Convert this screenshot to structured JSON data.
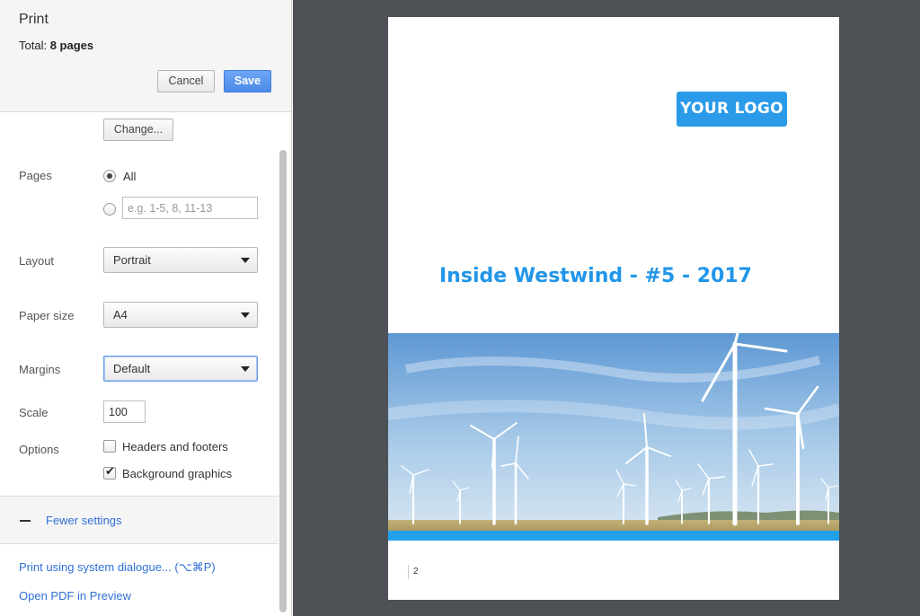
{
  "header": {
    "title": "Print",
    "total_label": "Total:",
    "total_value": "8 pages",
    "cancel_label": "Cancel",
    "save_label": "Save"
  },
  "destination": {
    "change_label": "Change..."
  },
  "pages": {
    "label": "Pages",
    "all_label": "All",
    "selected": "All",
    "custom_placeholder": "e.g. 1-5, 8, 11-13",
    "custom_value": ""
  },
  "layout": {
    "label": "Layout",
    "value": "Portrait"
  },
  "paper_size": {
    "label": "Paper size",
    "value": "A4"
  },
  "margins": {
    "label": "Margins",
    "value": "Default"
  },
  "scale": {
    "label": "Scale",
    "value": "100"
  },
  "options": {
    "label": "Options",
    "headers_footers_label": "Headers and footers",
    "headers_footers_checked": false,
    "background_graphics_label": "Background graphics",
    "background_graphics_checked": true
  },
  "fewer_settings_label": "Fewer settings",
  "links": {
    "system_dialogue": "Print using system dialogue... (⌥⌘P)",
    "open_pdf": "Open PDF in Preview"
  },
  "preview": {
    "logo_text": "YOUR LOGO",
    "title": "Inside Westwind - #5 - 2017",
    "page_number": "2"
  },
  "colors": {
    "accent": "#4a8ae8",
    "link": "#2f6fd6",
    "preview_background": "#4e5256",
    "brand_blue": "#2196e8"
  }
}
